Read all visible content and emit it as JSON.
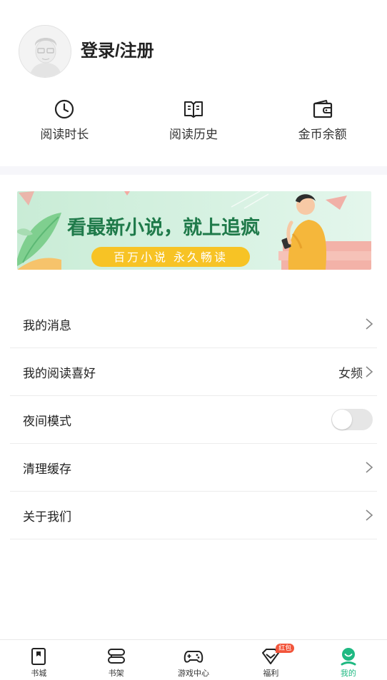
{
  "profile": {
    "login_label": "登录/注册"
  },
  "stats": [
    {
      "label": "阅读时长",
      "icon": "clock-icon"
    },
    {
      "label": "阅读历史",
      "icon": "book-icon"
    },
    {
      "label": "金币余额",
      "icon": "wallet-icon"
    }
  ],
  "banner": {
    "headline": "看最新小说，就上追疯",
    "tagline": "百万小说 永久畅读"
  },
  "menu": {
    "messages": "我的消息",
    "reading_pref": "我的阅读喜好",
    "reading_pref_value": "女频",
    "night_mode": "夜间模式",
    "night_mode_on": false,
    "clear_cache": "清理缓存",
    "about": "关于我们"
  },
  "tabs": [
    {
      "label": "书城",
      "icon": "bookstore-icon"
    },
    {
      "label": "书架",
      "icon": "bookshelf-icon"
    },
    {
      "label": "游戏中心",
      "icon": "gamepad-icon"
    },
    {
      "label": "福利",
      "icon": "gift-icon",
      "badge": "红包"
    },
    {
      "label": "我的",
      "icon": "profile-icon",
      "active": true
    }
  ],
  "colors": {
    "accent": "#1fb982",
    "badge": "#f2553b",
    "banner_text": "#1f7a4a",
    "banner_button": "#f7c325"
  }
}
